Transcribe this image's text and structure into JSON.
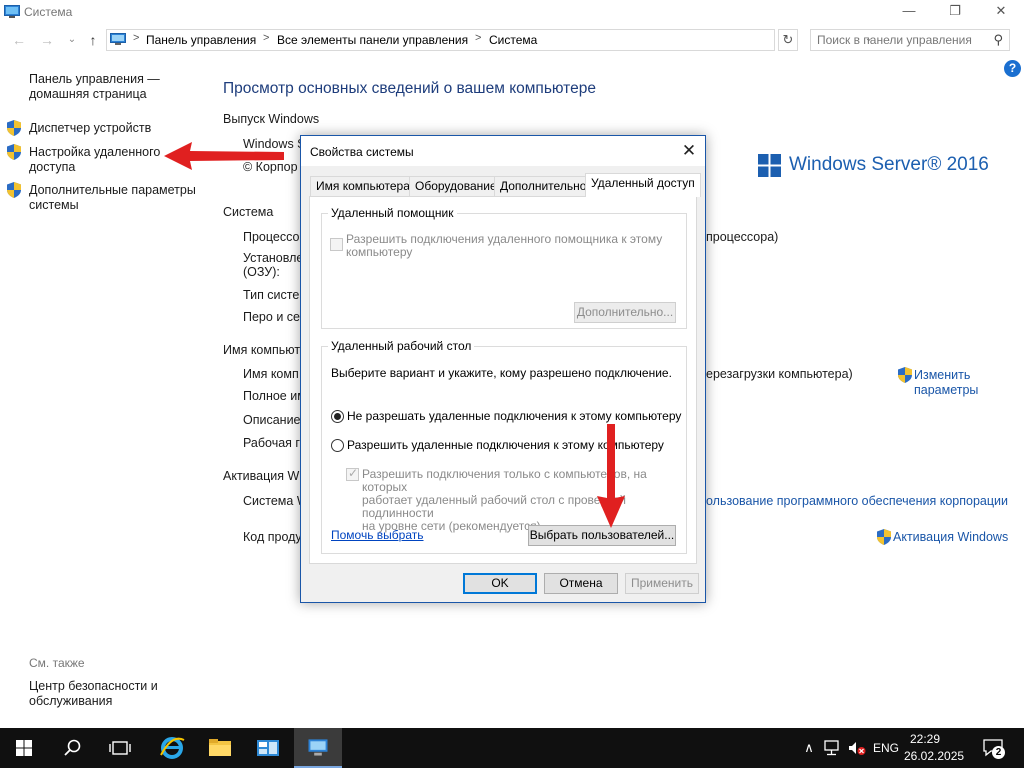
{
  "window": {
    "title": "Система",
    "minimize": "—",
    "maximize": "❐",
    "close": "✕"
  },
  "nav": {
    "back": "←",
    "forward": "→",
    "recent": "⌄",
    "up": "↑",
    "refresh": "↻"
  },
  "address": {
    "segments": [
      "Панель управления",
      "Все элементы панели управления",
      "Система"
    ],
    "sep": ">",
    "dropdown": "⌄"
  },
  "search": {
    "placeholder": "Поиск в панели управления",
    "icon": "⚲"
  },
  "help": "?",
  "leftnav": {
    "home_line1": "Панель управления —",
    "home_line2": "домашняя страница",
    "device_manager": "Диспетчер устройств",
    "remote_line1": "Настройка удаленного",
    "remote_line2": "доступа",
    "advanced_line1": "Дополнительные параметры",
    "advanced_line2": "системы",
    "see_also": "См. также",
    "security_line1": "Центр безопасности и",
    "security_line2": "обслуживания"
  },
  "main": {
    "heading": "Просмотр основных сведений о вашем компьютере",
    "edition_header": "Выпуск Windows",
    "edition_value": "Windows S",
    "copyright_value": "© Корпор",
    "logo_text": "Windows Server® 2016",
    "system_header": "Система",
    "processor_label": "Процессор",
    "processor_tail": "процессора)",
    "ram_label_1": "Установле",
    "ram_label_2": "(ОЗУ):",
    "systype_label": "Тип систем",
    "pen_label": "Перо и сен",
    "name_header": "Имя компьют",
    "compname_label": "Имя комп",
    "compname_tail": "ерезагрузки компьютера)",
    "fullname_label": "Полное им",
    "desc_label": "Описание",
    "workgroup_label": "Рабочая гр",
    "change_line1": "Изменить",
    "change_line2": "параметры",
    "activation_header": "Активация Wi",
    "activation_label": "Система W",
    "activation_tail": "ользование программного обеспечения корпорации",
    "productkey_label": "Код проду",
    "activate_link": "Активация Windows"
  },
  "dialog": {
    "title": "Свойства системы",
    "close": "✕",
    "tabs": [
      "Имя компьютера",
      "Оборудование",
      "Дополнительно",
      "Удаленный доступ"
    ],
    "assistance_group": "Удаленный помощник",
    "assistance_check_line1": "Разрешить подключения удаленного помощника к этому",
    "assistance_check_line2": "компьютеру",
    "advanced_btn": "Дополнительно...",
    "desktop_group": "Удаленный рабочий стол",
    "desktop_intro": "Выберите вариант и укажите, кому разрешено подключение.",
    "radio_deny": "Не разрешать удаленные подключения к этому компьютеру",
    "radio_allow": "Разрешить удаленные подключения к этому компьютеру",
    "nla_line1": "Разрешить подключения только с компьютеров, на которых",
    "nla_line2": "работает удаленный рабочий стол с проверкой подлинности",
    "nla_line3": "на уровне сети (рекомендуется)",
    "help_link": "Помочь выбрать",
    "select_users_btn": "Выбрать пользователей...",
    "ok": "OK",
    "cancel": "Отмена",
    "apply": "Применить"
  },
  "taskbar": {
    "tray_up": "∧",
    "lang": "ENG",
    "time": "22:29",
    "date": "26.02.2025",
    "notif_count": "2"
  },
  "colors": {
    "accent": "#0078d7",
    "heading_blue": "#1e3d7c",
    "link_blue": "#1a56a8",
    "arrow_red": "#e02020",
    "taskbar": "#101010"
  }
}
